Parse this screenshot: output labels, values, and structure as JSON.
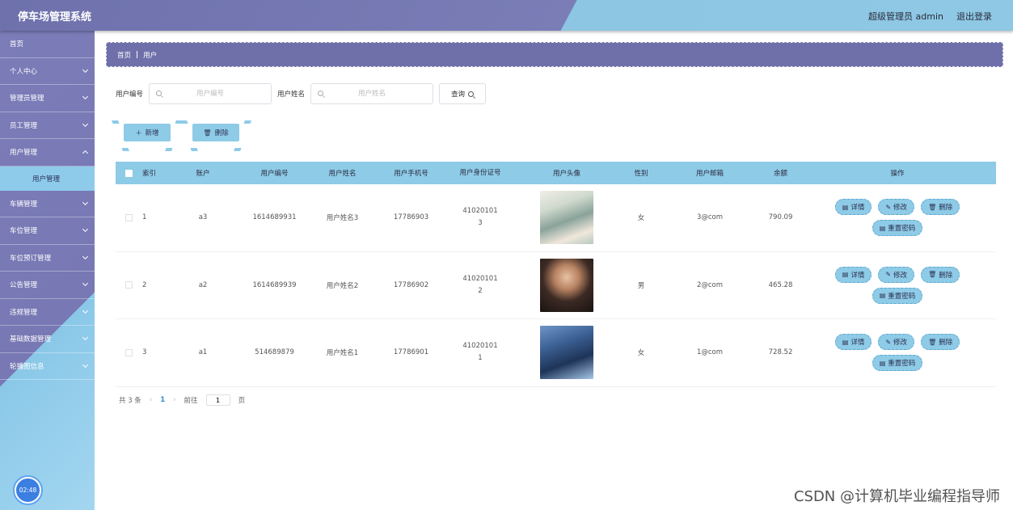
{
  "header": {
    "title": "停车场管理系统",
    "user": "超级管理员 admin",
    "logout": "退出登录"
  },
  "sidebar": {
    "items": [
      {
        "label": "首页"
      },
      {
        "label": "个人中心"
      },
      {
        "label": "管理员管理"
      },
      {
        "label": "员工管理"
      },
      {
        "label": "用户管理",
        "open": true,
        "sub": "用户管理"
      },
      {
        "label": "车辆管理"
      },
      {
        "label": "车位管理"
      },
      {
        "label": "车位预订管理"
      },
      {
        "label": "公告管理"
      },
      {
        "label": "违规管理"
      },
      {
        "label": "基础数据管理"
      },
      {
        "label": "轮播图信息"
      }
    ],
    "clock": "02:48"
  },
  "breadcrumb": {
    "home": "首页",
    "sep": "|",
    "current": "用户"
  },
  "search": {
    "num_label": "用户编号",
    "num_placeholder": "用户编号",
    "name_label": "用户姓名",
    "name_placeholder": "用户姓名",
    "query": "查询"
  },
  "actions": {
    "add": "新增",
    "delete": "删除"
  },
  "table": {
    "headers": [
      "索引",
      "账户",
      "用户编号",
      "用户姓名",
      "用户手机号",
      "用户身份证号",
      "用户头像",
      "性别",
      "用户邮箱",
      "余额",
      "操作"
    ],
    "rows": [
      {
        "index": "1",
        "account": "a3",
        "num": "1614689931",
        "name": "用户姓名3",
        "phone": "17786903",
        "id_line1": "41020101",
        "id_line2": "3",
        "sex": "女",
        "email": "3@com",
        "balance": "790.09"
      },
      {
        "index": "2",
        "account": "a2",
        "num": "1614689939",
        "name": "用户姓名2",
        "phone": "17786902",
        "id_line1": "41020101",
        "id_line2": "2",
        "sex": "男",
        "email": "2@com",
        "balance": "465.28"
      },
      {
        "index": "3",
        "account": "a1",
        "num": "514689879",
        "name": "用户姓名1",
        "phone": "17786901",
        "id_line1": "41020101",
        "id_line2": "1",
        "sex": "女",
        "email": "1@com",
        "balance": "728.52"
      }
    ],
    "ops": {
      "detail": "详情",
      "edit": "修改",
      "delete": "删除",
      "reset": "重置密码"
    }
  },
  "pager": {
    "total": "共 3 条",
    "prev": "‹",
    "page": "1",
    "next": "›",
    "goto": "前往",
    "goto_value": "1",
    "unit": "页"
  },
  "watermark": "CSDN @计算机毕业编程指导师"
}
